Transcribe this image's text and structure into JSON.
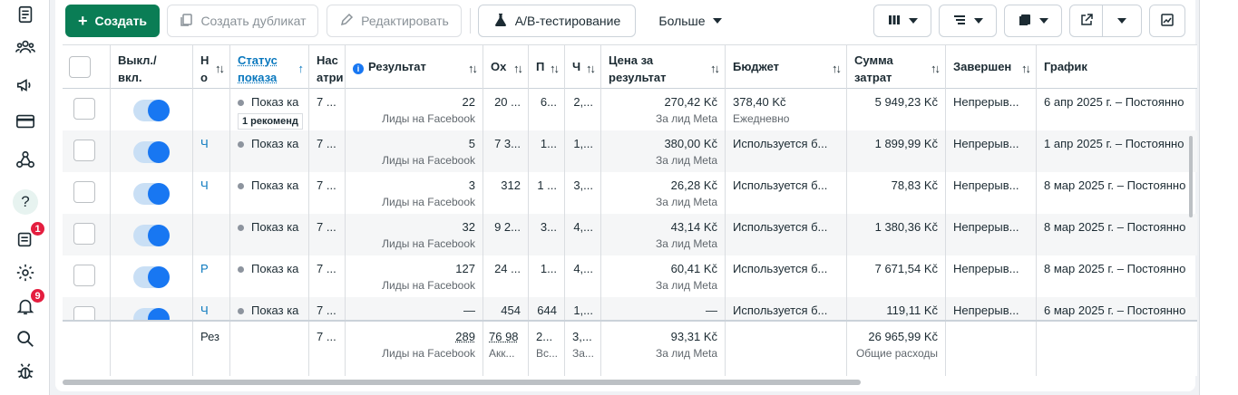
{
  "rail": {
    "icons": [
      "pages-icon",
      "audience-icon",
      "megaphone-icon",
      "billing-card-icon",
      "network-icon",
      "help-icon",
      "notifications-list-icon",
      "gear-icon",
      "bell-icon",
      "search-icon",
      "bug-icon"
    ],
    "help_label": "?",
    "list_badge": "1",
    "bell_badge": "9"
  },
  "toolbar": {
    "create_label": "Создать",
    "duplicate_label": "Создать дубликат",
    "edit_label": "Редактировать",
    "ab_label": "A/B-тестирование",
    "more_label": "Больше"
  },
  "columns": {
    "toggle": "Выкл./\nвкл.",
    "name": "Н\nо",
    "status": "Статус\nпоказа",
    "attribution": "Нас\nатри",
    "result": "Результат",
    "reach": "Ох",
    "impressions": "П",
    "freq": "Ч",
    "cost_per_result": "Цена за\nрезультат",
    "budget": "Бюджет",
    "amount_spent": "Сумма\nзатрат",
    "ends": "Завершен",
    "schedule": "График"
  },
  "rows": [
    {
      "name": "",
      "status": "Показ ка",
      "reco": "1 рекоменд",
      "attr": "7 ...",
      "result": "22",
      "result_sub": "Лиды на Facebook",
      "reach": "20 ...",
      "impr": "6...",
      "freq": "2,...",
      "cpr": "270,42 Kč",
      "cpr_sub": "За лид Meta",
      "budget": "378,40 Kč",
      "budget_sub": "Ежедневно",
      "spent": "5 949,23 Kč",
      "ends": "Непрерыв...",
      "schedule": "6 апр 2025 г. – Постоянно"
    },
    {
      "name": "Ч",
      "status": "Показ ка",
      "reco": "",
      "attr": "7 ...",
      "result": "5",
      "result_sub": "Лиды на Facebook",
      "reach": "7 3...",
      "impr": "1...",
      "freq": "1,...",
      "cpr": "380,00 Kč",
      "cpr_sub": "За лид Meta",
      "budget": "Используется б...",
      "budget_sub": "",
      "spent": "1 899,99 Kč",
      "ends": "Непрерыв...",
      "schedule": "1 апр 2025 г. – Постоянно"
    },
    {
      "name": "Ч",
      "status": "Показ ка",
      "reco": "",
      "attr": "7 ...",
      "result": "3",
      "result_sub": "Лиды на Facebook",
      "reach": "312",
      "impr": "1 ...",
      "freq": "3,...",
      "cpr": "26,28 Kč",
      "cpr_sub": "За лид Meta",
      "budget": "Используется б...",
      "budget_sub": "",
      "spent": "78,83 Kč",
      "ends": "Непрерыв...",
      "schedule": "8 мар 2025 г. – Постоянно"
    },
    {
      "name": "",
      "status": "Показ ка",
      "reco": "",
      "attr": "7 ...",
      "result": "32",
      "result_sub": "Лиды на Facebook",
      "reach": "9 2...",
      "impr": "3...",
      "freq": "4,...",
      "cpr": "43,14 Kč",
      "cpr_sub": "За лид Meta",
      "budget": "Используется б...",
      "budget_sub": "",
      "spent": "1 380,36 Kč",
      "ends": "Непрерыв...",
      "schedule": "8 мар 2025 г. – Постоянно"
    },
    {
      "name": "Р",
      "status": "Показ ка",
      "reco": "",
      "attr": "7 ...",
      "result": "127",
      "result_sub": "Лиды на Facebook",
      "reach": "24 ...",
      "impr": "1...",
      "freq": "4,...",
      "cpr": "60,41 Kč",
      "cpr_sub": "За лид Meta",
      "budget": "Используется б...",
      "budget_sub": "",
      "spent": "7 671,54 Kč",
      "ends": "Непрерыв...",
      "schedule": "8 мар 2025 г. – Постоянно"
    },
    {
      "name": "Ч",
      "status": "Показ ка",
      "reco": "",
      "attr": "7 ...",
      "result": "—",
      "result_sub": "",
      "reach": "454",
      "impr": "644",
      "freq": "1,...",
      "cpr": "—",
      "cpr_sub": "",
      "budget": "Используется б...",
      "budget_sub": "",
      "spent": "119,11 Kč",
      "ends": "Непрерыв...",
      "schedule": "6 мар 2025 г. – Постоянно"
    }
  ],
  "totals": {
    "name": "Рез",
    "attr": "7 ...",
    "result": "289",
    "result_sub": "Лиды на Facebook",
    "reach": "76 98",
    "reach_sub": "Акк...",
    "impr": "2...",
    "impr_sub": "Вс...",
    "freq": "3,...",
    "freq_sub": "За...",
    "cpr": "93,31 Kč",
    "cpr_sub": "За лид Meta",
    "spent": "26 965,99 Kč",
    "spent_sub": "Общие расходы"
  },
  "colors": {
    "accent": "#0a7d55",
    "link": "#0a78be",
    "toggle_on": "#1877f2",
    "badge": "#e41e3f"
  }
}
